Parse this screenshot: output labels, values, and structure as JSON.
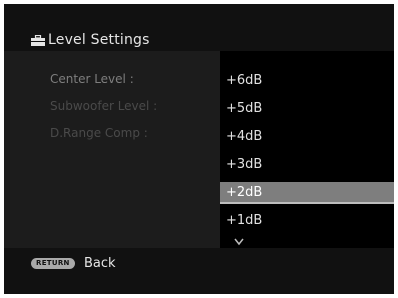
{
  "header": {
    "icon": "toolbox-icon",
    "title": "Level Settings"
  },
  "menu": {
    "items": [
      {
        "label": "Center Level :"
      },
      {
        "label": "Subwoofer Level :"
      },
      {
        "label": "D.Range Comp :"
      }
    ]
  },
  "dropdown": {
    "options": [
      "+6dB",
      "+5dB",
      "+4dB",
      "+3dB",
      "+2dB",
      "+1dB"
    ],
    "selected": "+2dB",
    "more_indicator": "chevron-down-icon"
  },
  "footer": {
    "return_badge": "RETURN",
    "back_label": "Back"
  },
  "colors": {
    "background": "#000000",
    "highlight": "#7e7e7e",
    "text": "#e2e2e2"
  }
}
